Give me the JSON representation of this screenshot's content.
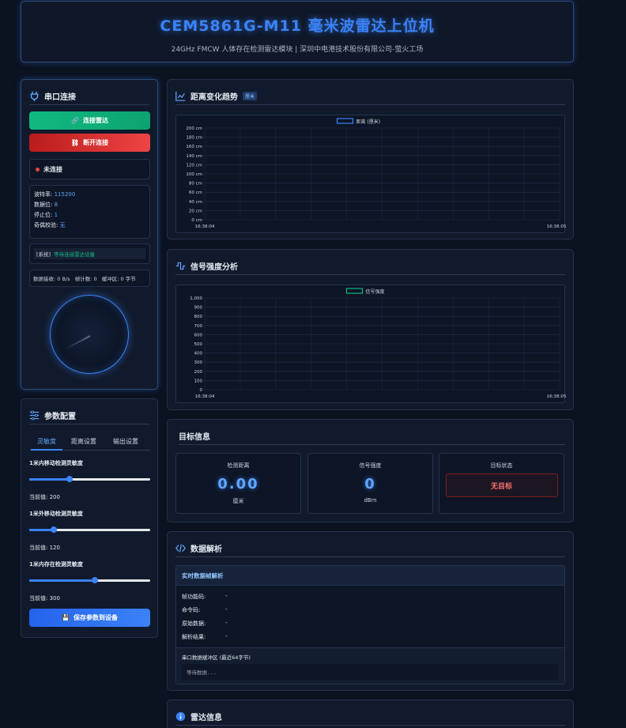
{
  "header": {
    "title": "CEM5861G-M11 毫米波雷达上位机",
    "subtitle": "24GHz FMCW 人体存在检测雷达模块 | 深圳中电港技术股份有限公司-萤火工场"
  },
  "serial": {
    "title": "串口连接",
    "connect_label": "连接雷达",
    "disconnect_label": "断开连接",
    "status": "未连接",
    "baud_label": "波特率:",
    "baud": "115200",
    "databits_label": "数据位:",
    "databits": "8",
    "stopbits_label": "停止位:",
    "stopbits": "1",
    "parity_label": "奇偶校验:",
    "parity": "无",
    "log_tag": "[系统]",
    "log_msg": "等待连接雷达设备",
    "stats": "数据接收: 0 B/s   帧计数: 0   缓冲区: 0 字节"
  },
  "params": {
    "title": "参数配置",
    "tabs": [
      "灵敏度",
      "距离设置",
      "输出设置"
    ],
    "sliders": [
      {
        "label": "1米内移动检测灵敏度",
        "current_label": "当前值:",
        "value": 200,
        "max": 600
      },
      {
        "label": "1米外移动检测灵敏度",
        "current_label": "当前值:",
        "value": 120,
        "max": 600
      },
      {
        "label": "1米内存在检测灵敏度",
        "current_label": "当前值:",
        "value": 300,
        "max": 550
      }
    ],
    "save_label": "保存参数到设备"
  },
  "distance_chart": {
    "title": "距离变化趋势",
    "badge": "厘米",
    "legend": "距离 (厘米)",
    "y_ticks": [
      "200 cm",
      "180 cm",
      "160 cm",
      "140 cm",
      "120 cm",
      "100 cm",
      "80 cm",
      "60 cm",
      "40 cm",
      "20 cm",
      "0 cm"
    ],
    "x_start": "16:38:04",
    "x_end": "16:38:05"
  },
  "signal_chart": {
    "title": "信号强度分析",
    "legend": "信号强度",
    "y_ticks": [
      "1,000",
      "900",
      "800",
      "700",
      "600",
      "500",
      "400",
      "300",
      "200",
      "100",
      "0"
    ],
    "x_start": "16:38:04",
    "x_end": "16:38:05"
  },
  "target": {
    "title": "目标信息",
    "distance_label": "检测距离",
    "distance": "0.00",
    "distance_unit": "厘米",
    "signal_label": "信号强度",
    "signal": "0",
    "signal_unit": "dBm",
    "state_label": "目标状态",
    "state": "无目标"
  },
  "parse": {
    "title": "数据解析",
    "subtitle": "实时数据帧解析",
    "rows": [
      {
        "label": "帧功能码:",
        "value": "-"
      },
      {
        "label": "命令码:",
        "value": "-"
      },
      {
        "label": "原始数据:",
        "value": "-"
      },
      {
        "label": "解析结果:",
        "value": "-"
      }
    ],
    "buffer_title": "串口数据缓冲区 (最近64字节)",
    "buffer_text": "等待数据..."
  },
  "radar_info": {
    "title": "雷达信息"
  },
  "colors": {
    "accent": "#3b82f6",
    "connect": "#10b981",
    "disconnect": "#dc2626",
    "danger": "#f87171"
  },
  "chart_data": [
    {
      "type": "line",
      "legend": [
        "距离 (厘米)"
      ],
      "series": [
        {
          "name": "距离 (厘米)",
          "values": []
        }
      ],
      "x": [
        "16:38:04",
        "16:38:05"
      ],
      "ylim": [
        0,
        200
      ],
      "grid": true,
      "legend_position": "top"
    },
    {
      "type": "area",
      "legend": [
        "信号强度"
      ],
      "series": [
        {
          "name": "信号强度",
          "values": []
        }
      ],
      "x": [
        "16:38:04",
        "16:38:05"
      ],
      "ylim": [
        0,
        1000
      ],
      "grid": true,
      "legend_position": "top"
    }
  ]
}
